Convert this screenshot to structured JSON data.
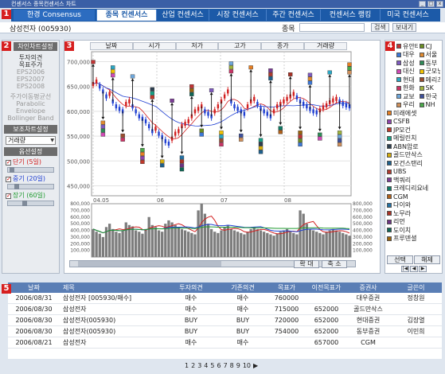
{
  "window": {
    "title": "컨센서스 종목컨센서스 차트"
  },
  "tabs": {
    "consensus": "한경 Consensus",
    "items": [
      "종목 컨센서스",
      "산업 컨센서스",
      "시장 컨센서스",
      "주간 컨센서스",
      "컨센서스 랭킹",
      "미국 컨센서스"
    ],
    "active_index": 0
  },
  "search": {
    "stock": "삼성전자 (005930)",
    "label": "종목",
    "search_btn": "검색",
    "send_btn": "보내기"
  },
  "badges": [
    "1",
    "2",
    "3",
    "4",
    "5"
  ],
  "left": {
    "head1": "차인차트설정",
    "indicators_on": [
      "투자의견",
      "목표주가"
    ],
    "indicators_off": [
      "EPS2006",
      "EPS2007",
      "EPS2008"
    ],
    "ma_list": [
      "주가이동평균선",
      "Parabolic",
      "Envelope",
      "Bollinger Band"
    ],
    "head2": "보조차트설정",
    "aux_select": "거래량",
    "head3": "옵션설정",
    "options": [
      {
        "label": "단기 (5일)",
        "color": "#d21f1f"
      },
      {
        "label": "중기 (20일)",
        "color": "#1f3fd2"
      },
      {
        "label": "장기 (60일)",
        "color": "#1f9a2f"
      }
    ]
  },
  "ohlc": [
    "날짜",
    "시가",
    "저가",
    "고가",
    "종가",
    "거래량"
  ],
  "chart_data": {
    "type": "scatter",
    "price_axis": {
      "ticks": [
        "700,000",
        "650,000",
        "600,000",
        "550,000",
        "500,000",
        "450,000"
      ],
      "ylim": [
        430000,
        720000
      ]
    },
    "x_ticks": [
      "04.05",
      "06",
      "07",
      "08"
    ],
    "volume_axis": {
      "ticks": [
        "800,000",
        "700,000",
        "600,000",
        "500,000",
        "400,000",
        "300,000",
        "200,000",
        "100,000"
      ],
      "ylim": [
        0,
        800000
      ]
    },
    "price_series": [
      655000,
      660000,
      650000,
      640000,
      630000,
      635000,
      620000,
      610000,
      605000,
      600000,
      615000,
      620000,
      610000,
      600000,
      590000,
      585000,
      580000,
      570000,
      560000,
      565000,
      555000,
      548000,
      540000,
      535000,
      545000,
      555000,
      560000,
      570000,
      575000,
      580000,
      590000,
      600000,
      605000,
      610000,
      600000,
      595000,
      590000,
      600000,
      610000,
      620000,
      630000,
      640000,
      620000,
      610000,
      605000,
      600000,
      595000,
      610000,
      620000,
      625000,
      615000,
      605000,
      600000,
      595000,
      590000,
      600000,
      610000,
      615000,
      620000,
      625000,
      630000,
      635000,
      628000,
      620000,
      615000,
      610000,
      605000,
      600000,
      598000,
      602000,
      608000,
      612000,
      618000,
      622000,
      625000,
      620000,
      615000,
      612000,
      610000
    ],
    "volume": [
      420000,
      380000,
      350000,
      300000,
      450000,
      500000,
      420000,
      380000,
      360000,
      400000,
      520000,
      480000,
      460000,
      400000,
      380000,
      350000,
      420000,
      600000,
      480000,
      450000,
      400000,
      380000,
      500000,
      550000,
      520000,
      480000,
      450000,
      420000,
      400000,
      380000,
      360000,
      340000,
      700000,
      800000,
      650000,
      500000,
      420000,
      380000,
      360000,
      400000,
      450000,
      480000,
      420000,
      400000,
      380000,
      360000,
      340000,
      380000,
      420000,
      450000,
      420000,
      400000,
      380000,
      360000,
      340000,
      320000,
      350000,
      380000,
      400000,
      420000,
      380000,
      360000,
      340000,
      700000,
      650000,
      500000,
      420000,
      400000,
      380000,
      360000,
      340000,
      380000,
      400000,
      420000,
      400000,
      380000,
      360000,
      340000,
      320000
    ]
  },
  "brokers": [
    {
      "name": "유안타",
      "color": "#c23434"
    },
    {
      "name": "CJ",
      "color": "#6b8e23"
    },
    {
      "name": "대우",
      "color": "#3c78d8"
    },
    {
      "name": "서울",
      "color": "#e08a2f"
    },
    {
      "name": "삼성",
      "color": "#7f5ac0"
    },
    {
      "name": "동부",
      "color": "#2e8b57"
    },
    {
      "name": "대신",
      "color": "#d14ab5"
    },
    {
      "name": "굿모닝",
      "color": "#f2c200"
    },
    {
      "name": "현대",
      "color": "#2aa7c4"
    },
    {
      "name": "메리츠",
      "color": "#9a4b2c"
    },
    {
      "name": "한화",
      "color": "#cc3366"
    },
    {
      "name": "SK",
      "color": "#a0b43c"
    },
    {
      "name": "교보",
      "color": "#6fa8dc"
    },
    {
      "name": "한국",
      "color": "#3d4f9c"
    },
    {
      "name": "우리",
      "color": "#cf8f5a"
    },
    {
      "name": "NH",
      "color": "#4aa84a"
    }
  ],
  "brokers_single": [
    {
      "name": "미래에셋",
      "color": "#e67e22"
    },
    {
      "name": "CSFB",
      "color": "#8e44ad"
    },
    {
      "name": "JP모건",
      "color": "#c0392b"
    },
    {
      "name": "메릴린치",
      "color": "#16a085"
    },
    {
      "name": "ABN암로",
      "color": "#2c3e50"
    },
    {
      "name": "골드만삭스",
      "color": "#d4ac0d"
    },
    {
      "name": "모건스탠리",
      "color": "#1f618d"
    },
    {
      "name": "UBS",
      "color": "#b03a2e"
    },
    {
      "name": "맥쿼리",
      "color": "#7d3c98"
    },
    {
      "name": "크레디리요네",
      "color": "#117a65"
    },
    {
      "name": "CGM",
      "color": "#af601a"
    },
    {
      "name": "다이와",
      "color": "#2471a3"
    },
    {
      "name": "노무라",
      "color": "#a93226"
    },
    {
      "name": "리먼",
      "color": "#6c3483"
    },
    {
      "name": "도이치",
      "color": "#0e6655"
    },
    {
      "name": "프루덴셜",
      "color": "#9c640c"
    }
  ],
  "right_buttons": {
    "select": "선택",
    "cancel": "해제"
  },
  "zoom": {
    "in": "확 대",
    "out": "축 소"
  },
  "table": {
    "headers": [
      "날짜",
      "제목",
      "투자의견",
      "기존의견",
      "목표가",
      "이전목표가",
      "증권사",
      "글쓴이"
    ],
    "rows": [
      [
        "2006/08/31",
        "삼성전자 [005930/매수]",
        "매수",
        "매수",
        "760000",
        "",
        "대우증권",
        "정창원"
      ],
      [
        "2006/08/30",
        "삼성전자",
        "매수",
        "매수",
        "715000",
        "652000",
        "골드만삭스",
        ""
      ],
      [
        "2006/08/30",
        "삼성전자(005930)",
        "BUY",
        "BUY",
        "720000",
        "652000",
        "현대증권",
        "김장열"
      ],
      [
        "2006/08/30",
        "삼성전자(005930)",
        "BUY",
        "BUY",
        "754000",
        "652000",
        "동부증권",
        "이민희"
      ],
      [
        "2006/08/21",
        "삼성전자",
        "매수",
        "매수",
        "",
        "657000",
        "CGM",
        ""
      ]
    ]
  },
  "pager": [
    "1",
    "2",
    "3",
    "4",
    "5",
    "6",
    "7",
    "8",
    "9",
    "10",
    "▶"
  ]
}
